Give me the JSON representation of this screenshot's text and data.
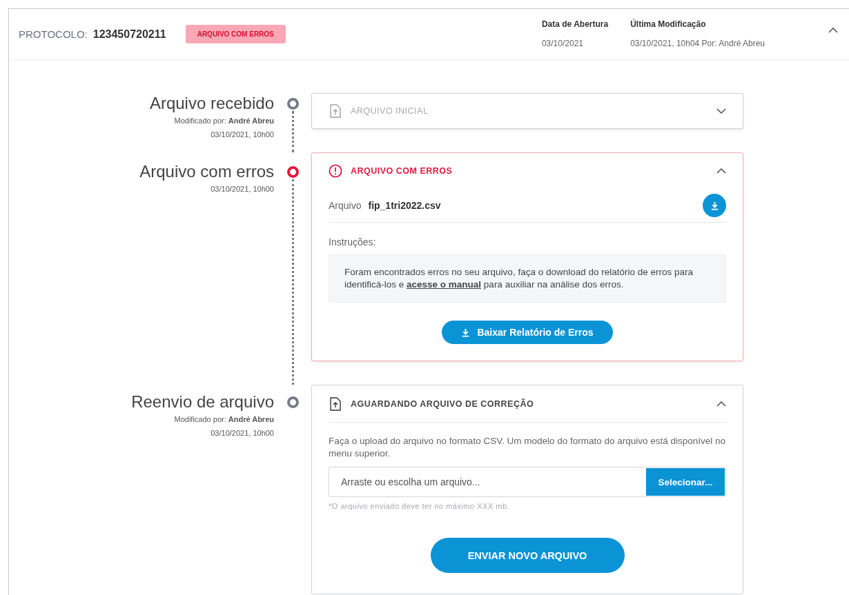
{
  "header": {
    "protocol_label": "PROTOCOLO:",
    "protocol_number": "123450720211",
    "status_badge": "ARQUIVO COM ERROS",
    "opening_date_label": "Data de Abertura",
    "opening_date": "03/10/2021",
    "last_modified_label": "Última Modificação",
    "last_modified": "03/10/2021, 10h04 Por: André Abreu",
    "expanded": true
  },
  "steps": [
    {
      "title": "Arquivo recebido",
      "color": "#767b88",
      "modified_by": "Modificado por: **André Abreu**",
      "date": "03/10/2021, 10h00",
      "card": {
        "kind": "collapsed",
        "title": "ARQUIVO INICIAL",
        "expanded": false
      }
    },
    {
      "title": "Arquivo com erros",
      "color": "#e5173f",
      "date": "03/10/2021, 10h00",
      "card": {
        "kind": "error",
        "title": "ARQUIVO COM ERROS",
        "expanded": true,
        "file_label": "Arquivo",
        "file_name": "fip_1tri2022.csv",
        "instructions_label": "Instruções:",
        "instructions_before": "Foram encontrados erros no seu arquivo, faça o download do relatório de erros para identificá-los e ",
        "instructions_link": "acesse o manual",
        "instructions_after": " para auxiliar na análise dos erros.",
        "button": "Baixar Relatório de Erros"
      }
    },
    {
      "title": "Reenvio de arquivo",
      "color": "#767b88",
      "modified_by": "Modificado por: **André Abreu**",
      "date": "03/10/2021, 10h00",
      "card": {
        "kind": "upload",
        "title": "AGUARDANDO ARQUIVO DE CORREÇÃO",
        "expanded": true,
        "description": "Faça o upload do arquivo no formato CSV. Um modelo do formato do arquivo está disponível no menu superior.",
        "placeholder": "Arraste ou escolha um arquivo...",
        "select_button": "Selecionar...",
        "note": "*O arquivo enviado deve ter no máximo XXX mb.",
        "submit_button": "ENVIAR NOVO ARQUIVO"
      }
    }
  ]
}
